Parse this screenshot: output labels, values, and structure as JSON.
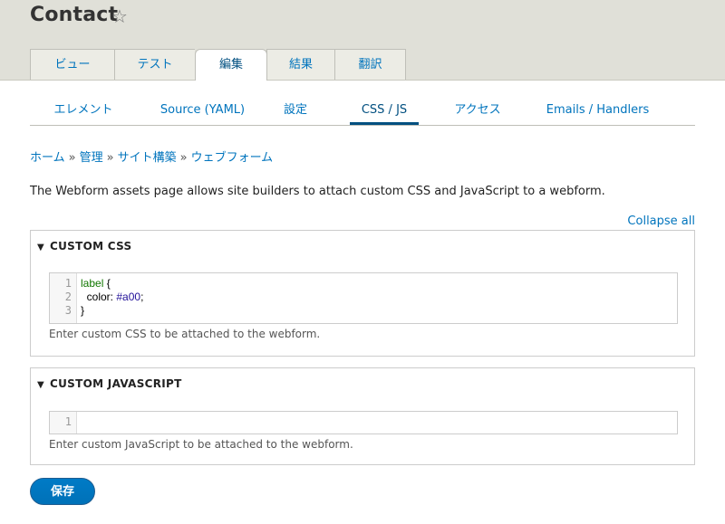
{
  "page": {
    "title": "Contact",
    "star_icon": "star-outline-icon"
  },
  "primary_tabs": [
    {
      "label": "ビュー"
    },
    {
      "label": "テスト"
    },
    {
      "label": "編集",
      "active": true
    },
    {
      "label": "結果"
    },
    {
      "label": "翻訳"
    }
  ],
  "secondary_tabs": [
    {
      "label": "エレメント"
    },
    {
      "label": "Source (YAML)"
    },
    {
      "label": "設定"
    },
    {
      "label": "CSS / JS",
      "active": true
    },
    {
      "label": "アクセス"
    },
    {
      "label": "Emails / Handlers"
    }
  ],
  "breadcrumb": {
    "items": [
      "ホーム",
      "管理",
      "サイト構築",
      "ウェブフォーム"
    ],
    "separator": "»"
  },
  "description": "The Webform assets page allows site builders to attach custom CSS and JavaScript to a webform.",
  "collapse_all": "Collapse all",
  "custom_css": {
    "summary": "CUSTOM CSS",
    "line_numbers": [
      "1",
      "2",
      "3"
    ],
    "code": {
      "line1_selector": "label",
      "line1_rest": " {",
      "line2_prop": "  color: ",
      "line2_value": "#a00",
      "line2_end": ";",
      "line3": "}"
    },
    "help": "Enter custom CSS to be attached to the webform."
  },
  "custom_js": {
    "summary": "CUSTOM JAVASCRIPT",
    "line_numbers": [
      "1"
    ],
    "help": "Enter custom JavaScript to be attached to the webform."
  },
  "save_label": "保存"
}
